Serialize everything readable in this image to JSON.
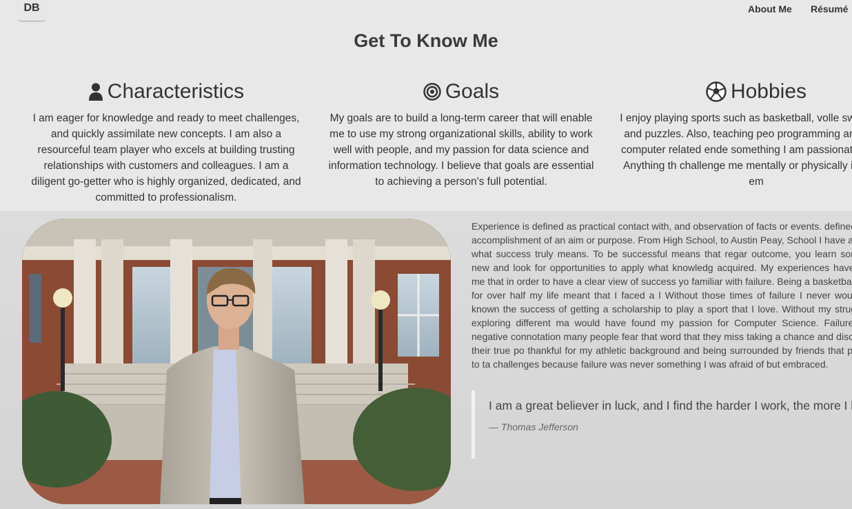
{
  "nav": {
    "brand": "DB",
    "about": "About Me",
    "resume": "Résumé"
  },
  "page": {
    "title": "Get To Know Me"
  },
  "columns": [
    {
      "icon": "user-icon",
      "heading": "Characteristics",
      "text": "I am eager for knowledge and ready to meet challenges, and quickly assimilate new concepts. I am also a resourceful team player who excels at building trusting relationships with customers and colleagues. I am a diligent go-getter who is highly organized, dedicated, and committed to professionalism."
    },
    {
      "icon": "target-icon",
      "heading": "Goals",
      "text": "My goals are to build a long-term career that will enable me to use my strong organizational skills, ability to work well with people, and my passion for data science and information technology. I believe that goals are essential to achieving a person's full potential."
    },
    {
      "icon": "soccer-ball-icon",
      "heading": "Hobbies",
      "text": "I enjoy playing sports such as basketball, volle swimming, and puzzles. Also, teaching peo programming and other computer related ende something I am passionate about. Anything th challenge me mentally or physically is gladly em"
    }
  ],
  "story": "Experience is defined as practical contact with, and observation of facts or events. defined as the accomplishment of an aim or purpose. From High School, to Austin Peay, School I have acquired what success truly means. To be successful means that regar outcome, you learn something new and look for opportunities to apply what knowledg acquired. My experiences have taught me that in order to have a clear view of success yo familiar with failure. Being a basketball player for over half my life meant that I faced a l Without those times of failure I never would have known the success of getting a scholarship to play a sport that I love. Without my struggles in exploring different ma would have found my passion for Computer Science. Failure has a negative connotation many people fear that word that they miss taking a chance and discovering their true po thankful for my athletic background and being surrounded by friends that push me to ta challenges because failure was never something I was afraid of but embraced.",
  "quote": {
    "text": "I am a great believer in luck, and I find the harder I work, the more I h it",
    "author": "— Thomas Jefferson"
  },
  "colors": {
    "background": "#e8e8e8",
    "lower_background": "#d8d8d8",
    "text": "#333333",
    "quote_border": "#f2f2f2"
  }
}
